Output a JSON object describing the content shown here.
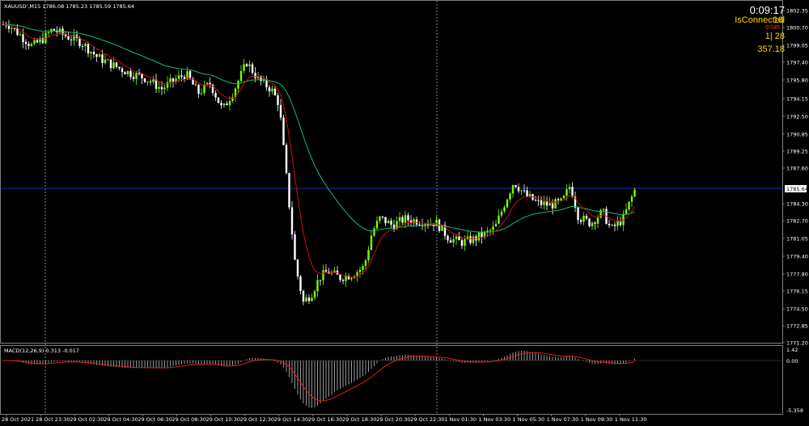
{
  "header": {
    "symbol_info": "XAUUSD',M15  1786.08 1785.23 1785.59 1785.64",
    "hud_timer": "0:09:17",
    "hud_status": "IsConnected",
    "hud_overlap": "16",
    "hud_change": "-0.545",
    "hud_misc": "1| 28",
    "hud_value": "357.18"
  },
  "macd": {
    "label": "MACD(12,26,9) 0.313 -0.017",
    "y_top_label": "1.42",
    "y_zero_label": "0.00",
    "y_bottom_label": "-5.358"
  },
  "price_axis": {
    "labels": [
      "1802.35",
      "1800.70",
      "1799.05",
      "1797.40",
      "1795.80",
      "1794.15",
      "1792.50",
      "1790.85",
      "1789.25",
      "1787.60",
      "1784.30",
      "1782.70",
      "1781.05",
      "1779.40",
      "1777.80",
      "1776.15",
      "1774.50",
      "1772.85",
      "1771.20"
    ],
    "current_price": "1785.64"
  },
  "time_axis": {
    "labels": [
      "28 Oct 2021",
      "28 Oct 23:30",
      "29 Oct 02:30",
      "29 Oct 04:30",
      "29 Oct 06:30",
      "29 Oct 08:30",
      "29 Oct 10:30",
      "29 Oct 12:30",
      "29 Oct 14:30",
      "29 Oct 16:30",
      "29 Oct 18:30",
      "29 Oct 20:30",
      "29 Oct 22:30",
      "1 Nov 01:30",
      "1 Nov 03:30",
      "1 Nov 05:30",
      "1 Nov 07:30",
      "1 Nov 09:30",
      "1 Nov 11:30"
    ]
  },
  "colors": {
    "background": "#000000",
    "bull_candle": "#7CFC00",
    "bear_candle": "#ffffff",
    "fast_ma": "#d01010",
    "slow_ma": "#10c070",
    "macd_hist": "#c0c0c0",
    "macd_signal": "#e02020",
    "price_line": "#2040ff",
    "hud_text": "#ffd800",
    "hud_red": "#ff3030"
  }
}
